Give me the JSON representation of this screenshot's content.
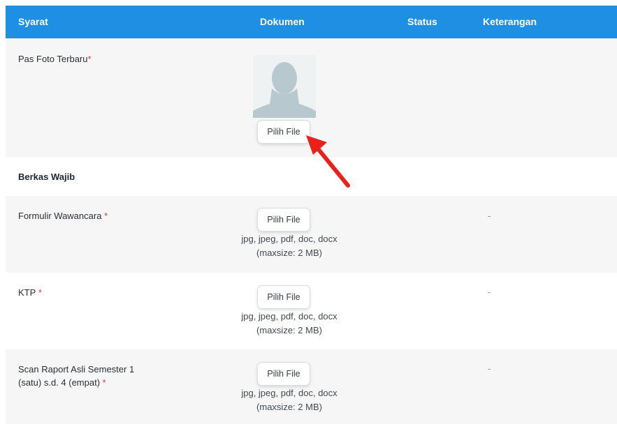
{
  "header": {
    "syarat": "Syarat",
    "dokumen": "Dokumen",
    "status": "Status",
    "keterangan": "Keterangan"
  },
  "photo_row": {
    "label": "Pas Foto Terbaru",
    "required_mark": "*",
    "button": "Pilih File"
  },
  "section": {
    "title": "Berkas Wajib"
  },
  "documents": [
    {
      "label": "Formulir Wawancara",
      "required_mark": "*",
      "button": "Pilih File",
      "formats": "jpg, jpeg, pdf, doc, docx",
      "maxsize": "(maxsize: 2 MB)",
      "keterangan": "-"
    },
    {
      "label": "KTP",
      "required_mark": "*",
      "button": "Pilih File",
      "formats": "jpg, jpeg, pdf, doc, docx",
      "maxsize": "(maxsize: 2 MB)",
      "keterangan": "-"
    },
    {
      "label_line1": "Scan Raport Asli Semester 1",
      "label_line2": "(satu) s.d. 4 (empat)",
      "required_mark": "*",
      "button": "Pilih File",
      "formats": "jpg, jpeg, pdf, doc, docx",
      "maxsize": "(maxsize: 2 MB)",
      "keterangan": "-"
    }
  ],
  "colors": {
    "header_bg": "#1f8fe3",
    "row_alt_bg": "#f6f6f6",
    "required_star": "#e53935",
    "annotation_arrow": "#e8211b"
  },
  "icons": {
    "avatar": "person-silhouette-icon",
    "annotation": "red-arrow-icon"
  }
}
